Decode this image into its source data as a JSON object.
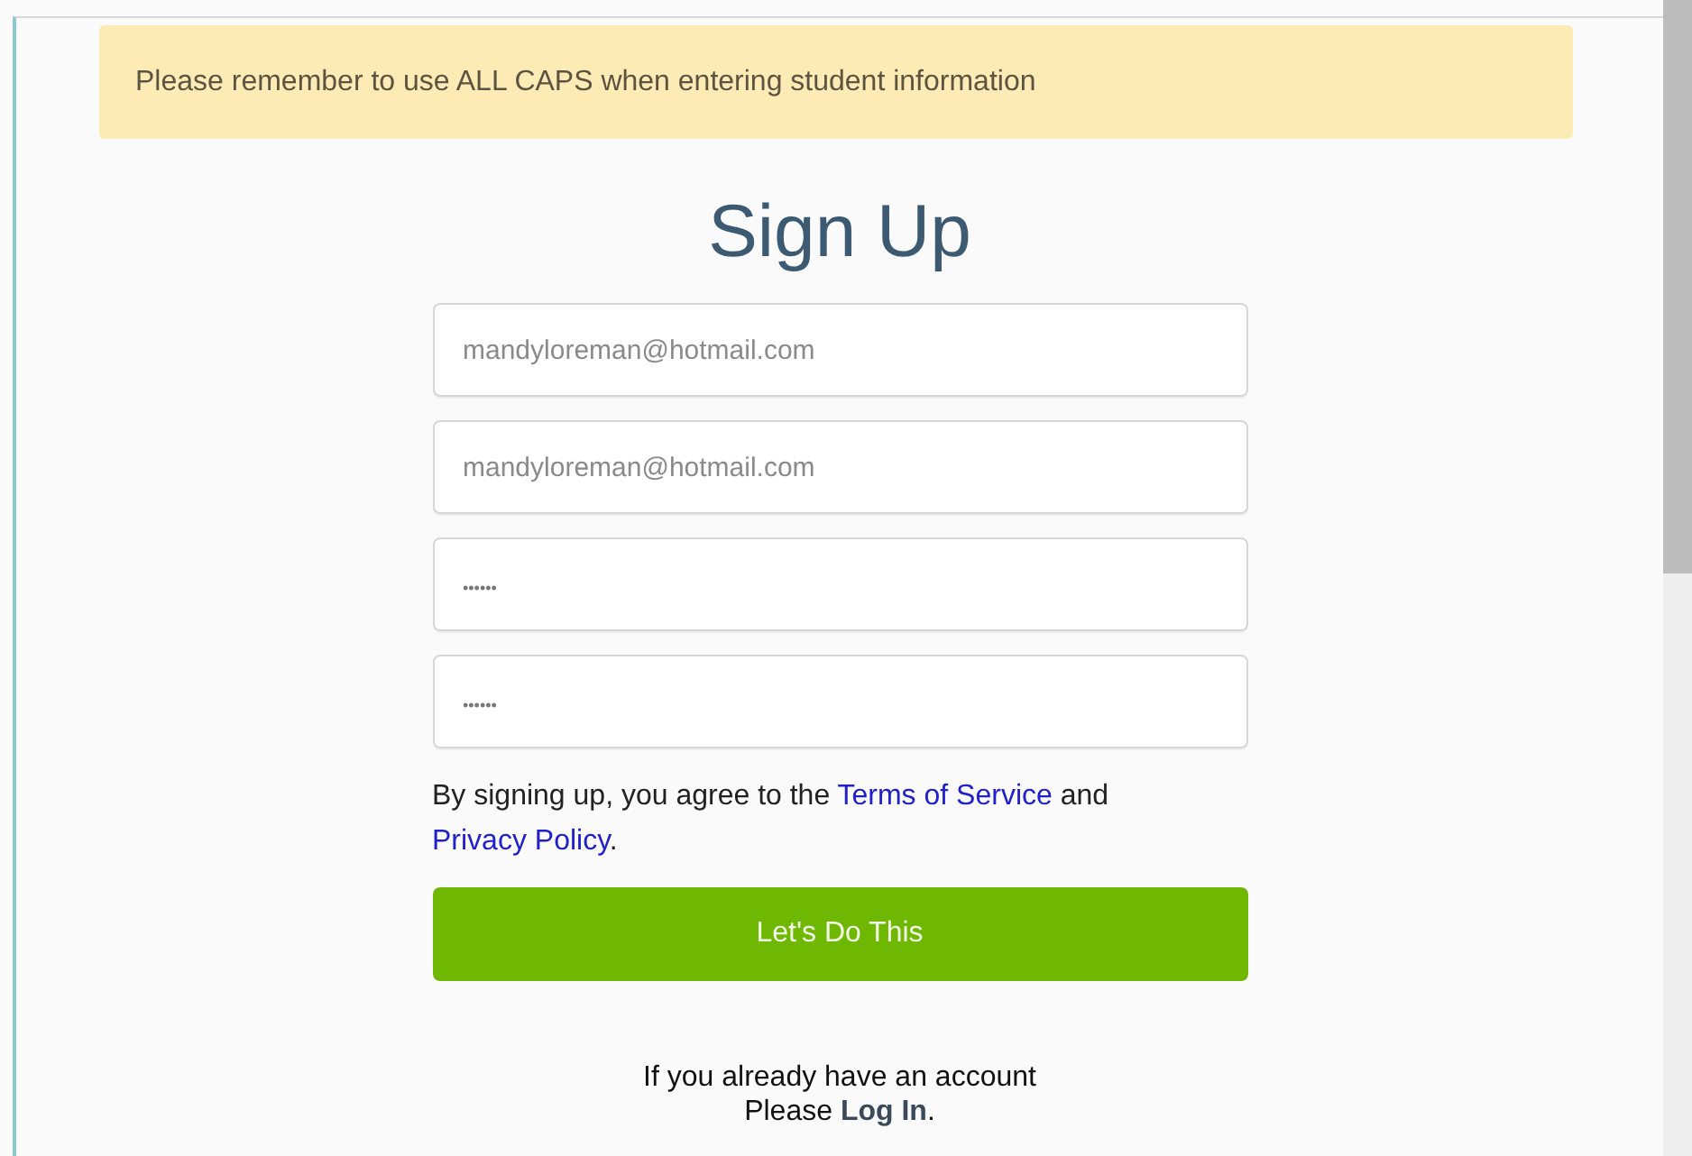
{
  "alert": {
    "text": "Please remember to use ALL CAPS when entering student information"
  },
  "title": "Sign Up",
  "fields": [
    {
      "kind": "email",
      "placeholder": "mandyloreman@hotmail.com"
    },
    {
      "kind": "email",
      "placeholder": "mandyloreman@hotmail.com"
    },
    {
      "kind": "password",
      "placeholder": "••••••"
    },
    {
      "kind": "password",
      "placeholder": "••••••"
    }
  ],
  "terms": [
    {
      "kind": "text",
      "text": "By signing up, you agree to the "
    },
    {
      "kind": "link",
      "text": "Terms of Service"
    },
    {
      "kind": "text",
      "text": " and "
    },
    {
      "kind": "link",
      "text": "Privacy Policy"
    },
    {
      "kind": "text",
      "text": "."
    }
  ],
  "submit_button": "Let's Do This",
  "login": {
    "line_1": "If you already have an account",
    "prompt": "Please ",
    "link": "Log In",
    "end": "."
  }
}
